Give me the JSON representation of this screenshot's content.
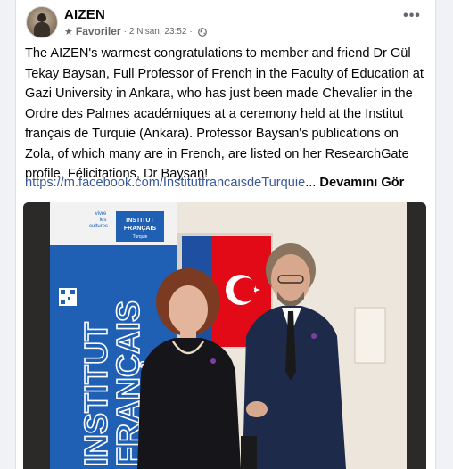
{
  "post": {
    "author": "AIZEN",
    "favorites_label": "Favoriler",
    "separator": "·",
    "timestamp": "2 Nisan, 23:52",
    "more_options": "•••",
    "body": "The AIZEN's warmest congratulations to member and friend Dr Gül\nTekay Baysan, Full Professor of French in the Faculty of Education at\nGazi University in Ankara, who has just been made Chevalier in the\nOrdre des Palmes académiques at a ceremony held at the Institut\nfrançais de Turquie (Ankara). Professor Baysan's publications on\nZola, of which many are in French, are listed on her ResearchGate\nprofile. Félicitations, Dr Baysan!",
    "link": "https://m.facebook.com/InstitutfrancaisdeTurquie",
    "ellipsis": "...",
    "see_more": "Devamını Gör"
  },
  "photo": {
    "banner_top": "vivre\nles\ncultures",
    "logo_line1": "INSTITUT",
    "logo_line2": "FRANÇAIS",
    "logo_line3": "Turquie",
    "banner_vertical_1": "INSTITUT",
    "banner_vertical_2": "FRANÇAIS"
  },
  "colors": {
    "link": "#385898",
    "banner_blue": "#1f5fb4",
    "flag_red": "#e30a17",
    "meta_gray": "#65676b"
  },
  "icons": {
    "favorites": "star-icon",
    "audience": "globe-icon",
    "menu": "more-horizontal-icon"
  }
}
